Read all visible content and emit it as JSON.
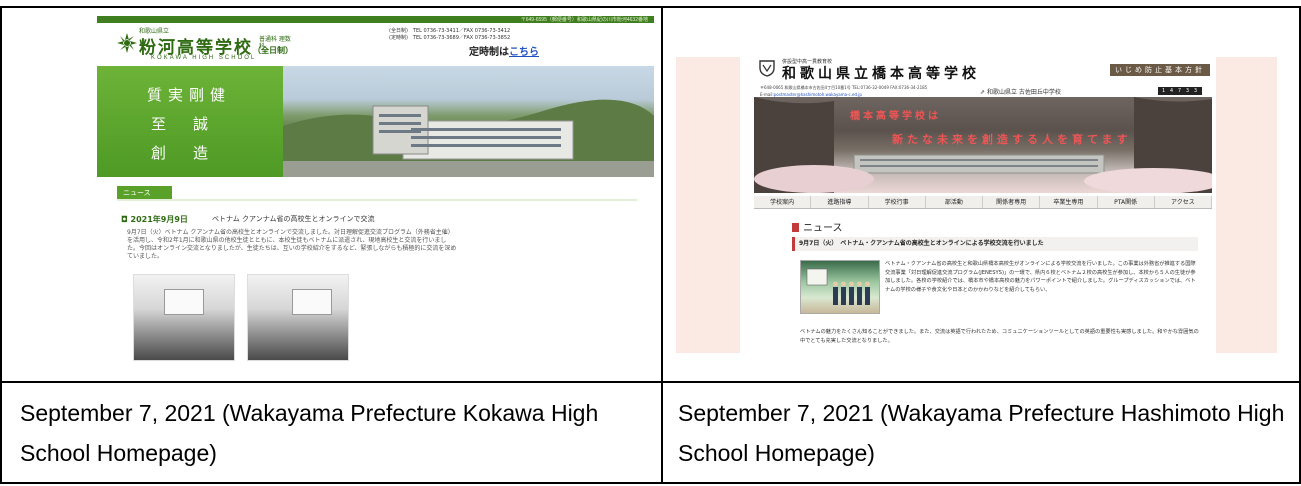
{
  "captions": {
    "left": "September 7, 2021 (Wakayama Prefecture Kokawa High School Homepage)",
    "right": "September 7, 2021 (Wakayama Prefecture Hashimoto High School Homepage)"
  },
  "kokawa": {
    "top_strip": "〒649-6595（郵便番号）和歌山県紀の川市粉河4632番地",
    "prefecture": "和歌山県立",
    "school_name": "粉河高等学校",
    "school_name_suffix": "（全日制）",
    "courses": "普通科 理数科",
    "english_name": "KOKAWA HIGH SCHOOL",
    "contact_day": "(全日制)　TEL 0736-73-3411／FAX 0736-73-3412",
    "contact_night": "(定時制)　TEL 0736-73-3689／FAX 0736-73-3852",
    "teiji_text": "定時制は",
    "teiji_link": "こちら",
    "motto": [
      "質実剛健",
      "至　誠",
      "創　造"
    ],
    "news_tab": "ニュース",
    "article_date": "2021年9月9日",
    "article_title": "ベトナム クアンナム省の高校生とオンラインで交流",
    "article_body": "9月7日（火）ベトナム クアンナム省の高校生とオンラインで交流しました。対日理解促進交流プログラム（外務省主催）を活用し、令和2年1月に和歌山県の他校生徒とともに、本校生徒もベトナムに派遣され、現地高校生と交流を行いました。今回はオンライン交流となりましたが、生徒たちは、互いの学校紹介をするなど、緊張しながらも積極的に交流を深めていました。"
  },
  "hashimoto": {
    "subtitle": "併設型中高一貫教育校",
    "school_name": "和歌山県立橋本高等学校",
    "ijime_button": "いじめ防止基本方針",
    "address": "〒648-0065 和歌山県橋本市古佐田4丁目10番1号 TEL:0736-32-0049 FAX:0736-34-2185",
    "email_label": "E-mail:",
    "email": "postmaster@hashimotoh.wakayama-c.ed.jp",
    "jhs_link": "和歌山県立 古佐田丘中学校",
    "counter": "1 4 7 3 3 3",
    "slogan_line1": "橋本高等学校は",
    "slogan_line2": "新たな未来を創造する人を育てます",
    "nav": [
      "学校案内",
      "進路指導",
      "学校行事",
      "部活動",
      "関係者専用",
      "卒業生専用",
      "PTA関係",
      "アクセス"
    ],
    "news_heading": "ニュース",
    "article_title": "9月7日（火）　ベトナム・クアンナム省の高校生とオンラインによる学校交流を行いました",
    "article_body": "ベトナム・クアンナム省の高校生と和歌山県橋本高校生がオンラインによる学校交流を行いました。この事業は外務省が推進する国際交流事業「対日理解促進交流プログラム(JENESYS)」の一環で、県内６校とベトナム２校の高校生が参加し、本校から５人の生徒が参加しました。各校の学校紹介では、橋本市や橋本高校の魅力をパワーポイントで紹介しました。グループディスカッションでは、ベトナムの学校の様子や食文化や日本とのかかわりなどを紹介してもらい、",
    "article_body_cont": "ベトナムの魅力をたくさん知ることができました。また、交流は英語で行われたため、コミュニケーションツールとしての英語の重要性も実感しました。和やかな雰囲気の中でとても充実した交流となりました。"
  }
}
